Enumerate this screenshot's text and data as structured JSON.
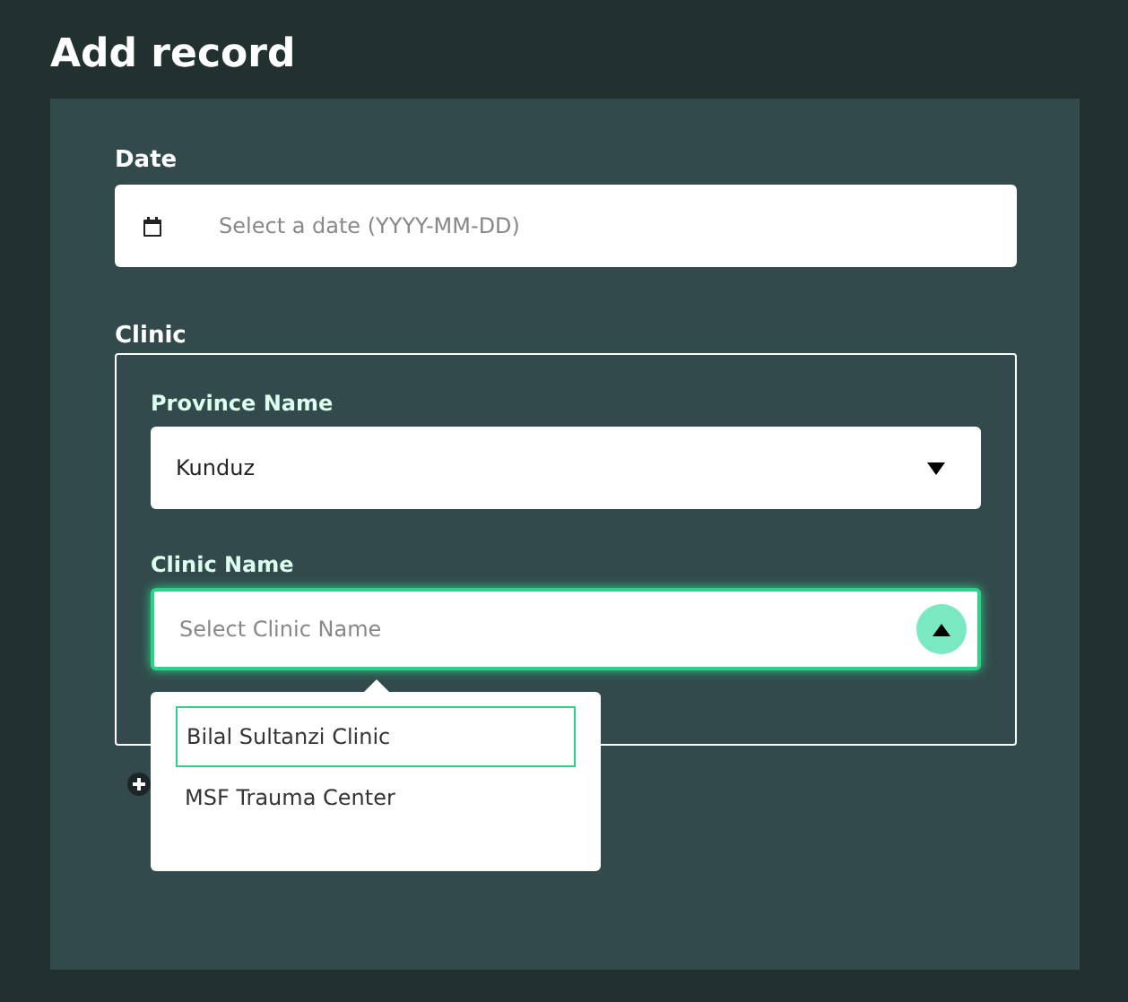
{
  "title": "Add record",
  "date": {
    "label": "Date",
    "placeholder": "Select a date (YYYY-MM-DD)"
  },
  "clinic": {
    "label": "Clinic",
    "province": {
      "label": "Province Name",
      "value": "Kunduz"
    },
    "clinic_name": {
      "label": "Clinic Name",
      "placeholder": "Select Clinic Name",
      "expanded": true,
      "options": [
        {
          "label": "Bilal Sultanzi Clinic",
          "selected": true
        },
        {
          "label": "MSF Trauma Center",
          "selected": false
        }
      ]
    }
  }
}
